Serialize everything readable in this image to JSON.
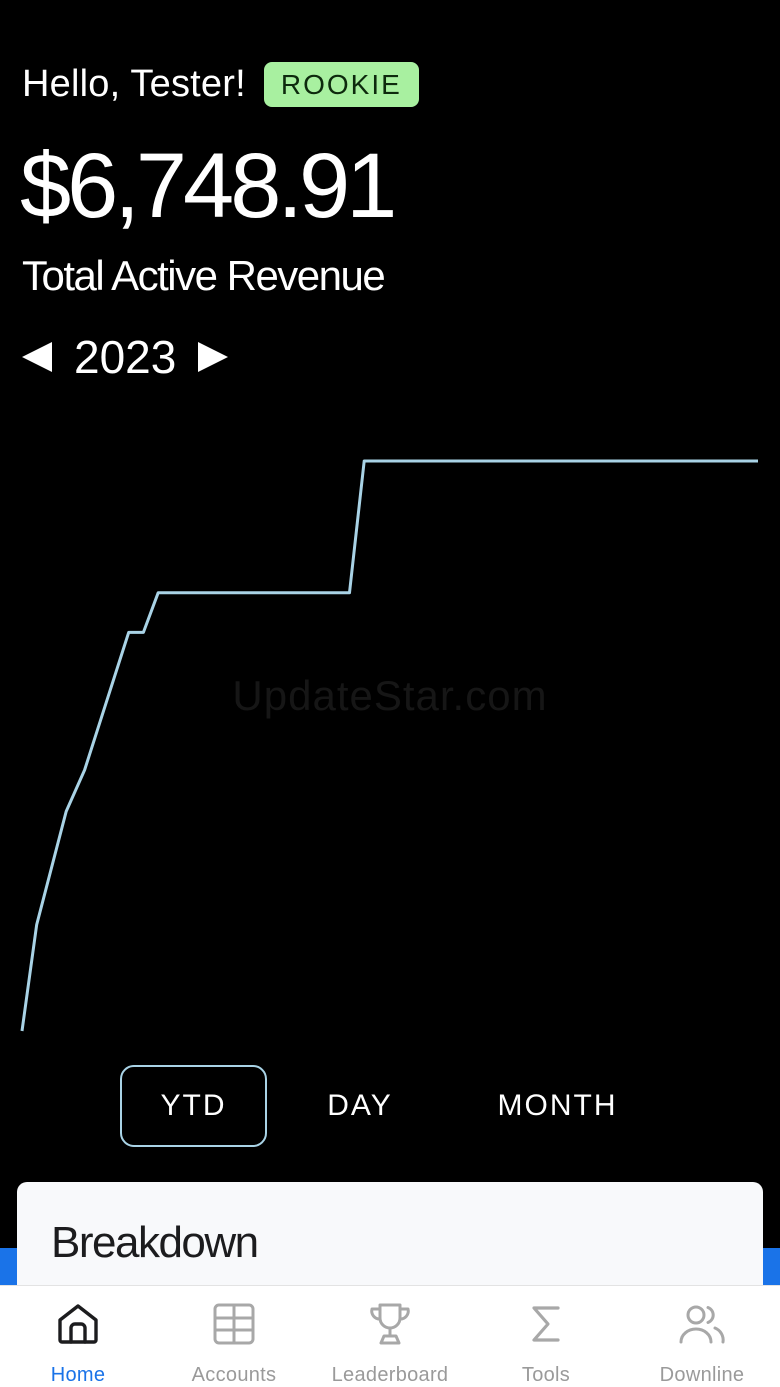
{
  "header": {
    "greeting": "Hello, Tester!",
    "badge": "ROOKIE",
    "amount": "$6,748.91",
    "amount_label": "Total Active Revenue",
    "year": "2023"
  },
  "watermark": "UpdateStar.com",
  "colors": {
    "line": "#a9d3e6",
    "badge_bg": "#a8f0a0",
    "accent": "#1a73e8"
  },
  "chart_data": {
    "type": "line",
    "title": "",
    "xlabel": "",
    "ylabel": "",
    "grid": false,
    "legend": "none",
    "xlim": [
      0,
      100
    ],
    "ylim": [
      0,
      6748.91
    ],
    "series": [
      {
        "points": [
          [
            0,
            0
          ],
          [
            2,
            1260
          ],
          [
            6,
            2600
          ],
          [
            8.5,
            3090
          ],
          [
            14.5,
            4720
          ],
          [
            16.5,
            4720
          ],
          [
            18.5,
            5190
          ],
          [
            44.5,
            5190
          ],
          [
            46.5,
            6748.91
          ],
          [
            100,
            6748.91
          ]
        ]
      }
    ]
  },
  "range_options": [
    {
      "label": "YTD",
      "active": true
    },
    {
      "label": "DAY",
      "active": false
    },
    {
      "label": "MONTH",
      "active": false
    }
  ],
  "card": {
    "title": "Breakdown"
  },
  "tabs": [
    {
      "label": "Home",
      "icon": "home-icon",
      "active": true
    },
    {
      "label": "Accounts",
      "icon": "table-icon",
      "active": false
    },
    {
      "label": "Leaderboard",
      "icon": "trophy-icon",
      "active": false
    },
    {
      "label": "Tools",
      "icon": "sigma-icon",
      "active": false
    },
    {
      "label": "Downline",
      "icon": "users-icon",
      "active": false
    }
  ]
}
